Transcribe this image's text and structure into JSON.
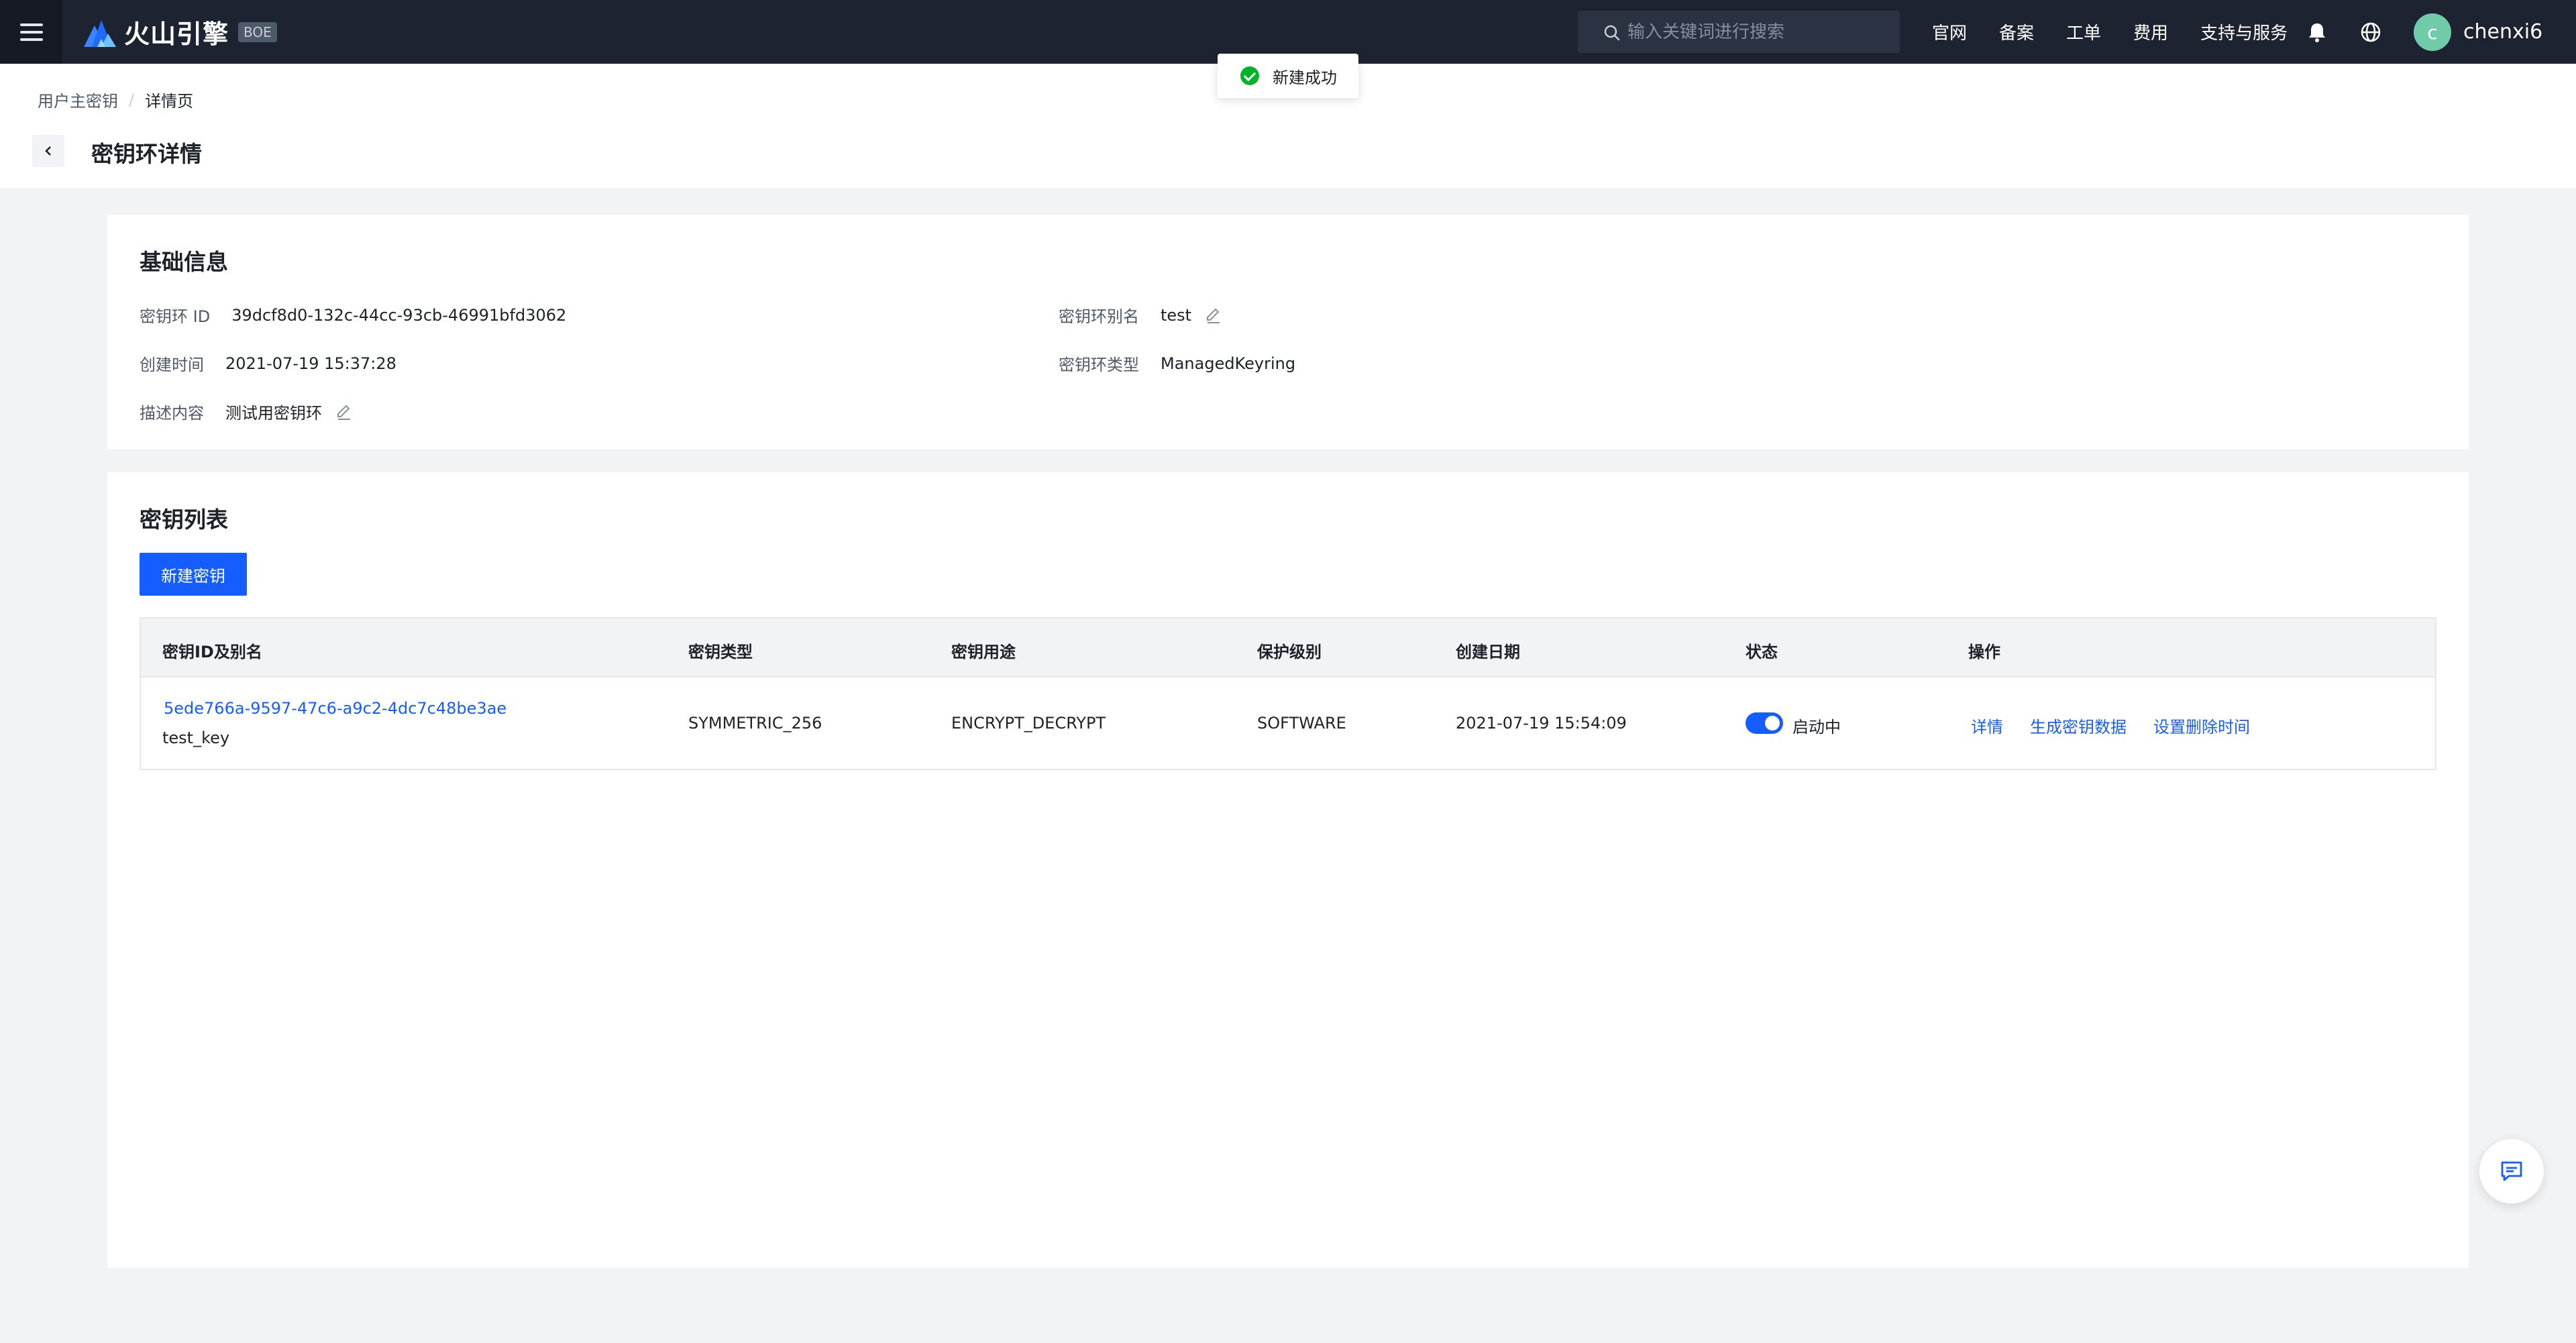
{
  "topbar": {
    "logo_text": "火山引擎",
    "env_badge": "BOE",
    "search_placeholder": "输入关键词进行搜索",
    "nav": [
      "官网",
      "备案",
      "工单",
      "费用",
      "支持与服务"
    ],
    "avatar_letter": "c",
    "username": "chenxi6",
    "colors": {
      "bar": "#1d2330",
      "avatar": "#6fcba8"
    }
  },
  "toast": {
    "message": "新建成功",
    "icon": "check-circle-icon"
  },
  "breadcrumb": {
    "parent": "用户主密钥",
    "separator": "/",
    "current": "详情页"
  },
  "page": {
    "title": "密钥环详情"
  },
  "basic_info": {
    "title": "基础信息",
    "keyring_id": {
      "label": "密钥环 ID",
      "value": "39dcf8d0-132c-44cc-93cb-46991bfd3062"
    },
    "alias": {
      "label": "密钥环别名",
      "value": "test"
    },
    "created": {
      "label": "创建时间",
      "value": "2021-07-19 15:37:28"
    },
    "type": {
      "label": "密钥环类型",
      "value": "ManagedKeyring"
    },
    "description": {
      "label": "描述内容",
      "value": "测试用密钥环"
    }
  },
  "key_list": {
    "title": "密钥列表",
    "new_button": "新建密钥",
    "columns": [
      "密钥ID及别名",
      "密钥类型",
      "密钥用途",
      "保护级别",
      "创建日期",
      "状态",
      "操作"
    ],
    "rows": [
      {
        "key_id": "5ede766a-9597-47c6-a9c2-4dc7c48be3ae",
        "alias": "test_key",
        "key_type": "SYMMETRIC_256",
        "usage": "ENCRYPT_DECRYPT",
        "protection": "SOFTWARE",
        "created": "2021-07-19 15:54:09",
        "status": "启动中",
        "status_on": true,
        "actions": [
          "详情",
          "生成密钥数据",
          "设置删除时间"
        ]
      }
    ]
  },
  "accent_color": "#165dff"
}
